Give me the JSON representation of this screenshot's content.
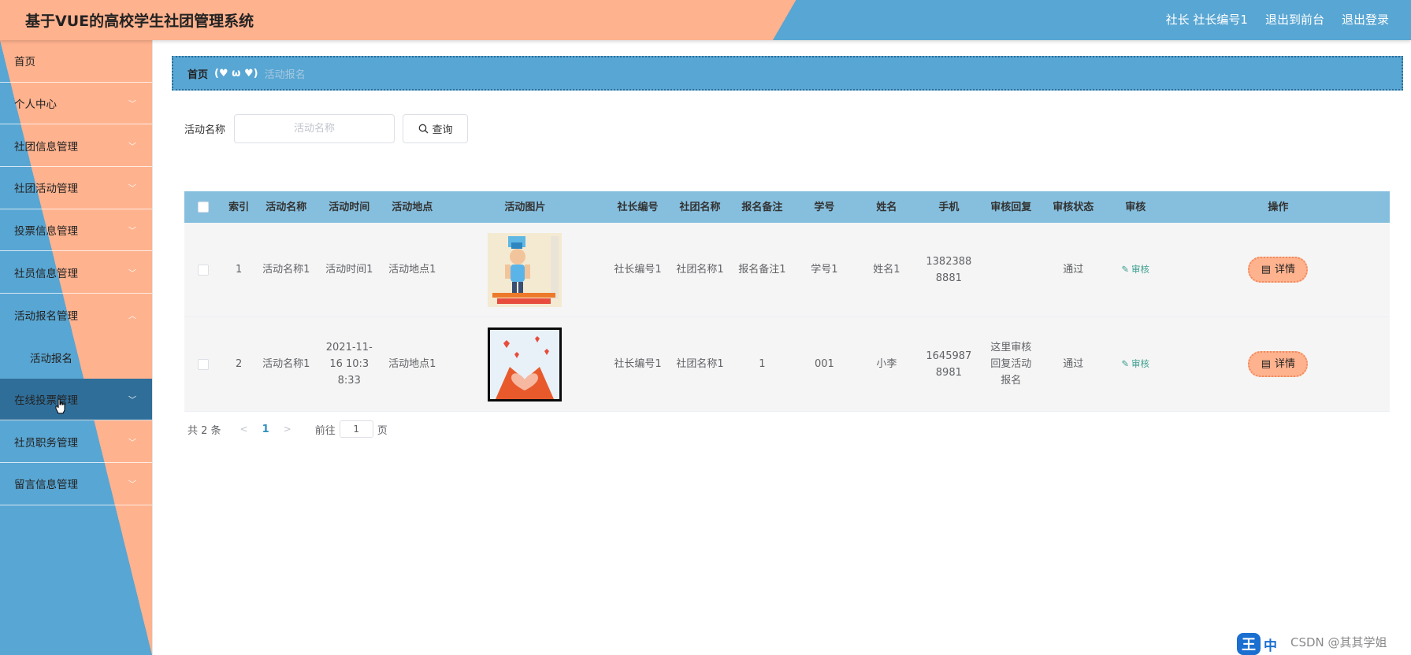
{
  "header": {
    "title": "基于VUE的高校学生社团管理系统",
    "user": "社长 社长编号1",
    "back_front": "退出到前台",
    "logout": "退出登录"
  },
  "sidebar": {
    "items": [
      {
        "label": "首页"
      },
      {
        "label": "个人中心"
      },
      {
        "label": "社团信息管理"
      },
      {
        "label": "社团活动管理"
      },
      {
        "label": "投票信息管理"
      },
      {
        "label": "社员信息管理"
      },
      {
        "label": "活动报名管理"
      },
      {
        "label": "活动报名"
      },
      {
        "label": "在线投票管理"
      },
      {
        "label": "社员职务管理"
      },
      {
        "label": "留言信息管理"
      }
    ]
  },
  "breadcrumb": {
    "home": "首页",
    "sep": "(♥ ω ♥)",
    "current": "活动报名"
  },
  "search": {
    "label": "活动名称",
    "placeholder": "活动名称",
    "button": "查询"
  },
  "table": {
    "headers": [
      "索引",
      "活动名称",
      "活动时间",
      "活动地点",
      "活动图片",
      "社长编号",
      "社团名称",
      "报名备注",
      "学号",
      "姓名",
      "手机",
      "审核回复",
      "审核状态",
      "审核",
      "操作"
    ],
    "rows": [
      {
        "index": "1",
        "name": "活动名称1",
        "time": "活动时间1",
        "location": "活动地点1",
        "leader_id": "社长编号1",
        "club": "社团名称1",
        "note": "报名备注1",
        "student_no": "学号1",
        "student_name": "姓名1",
        "phone": "13823888881",
        "reply": "",
        "status": "通过",
        "review": "审核",
        "detail": "详情"
      },
      {
        "index": "2",
        "name": "活动名称1",
        "time": "2021-11-16 10:38:33",
        "location": "活动地点1",
        "leader_id": "社长编号1",
        "club": "社团名称1",
        "note": "1",
        "student_no": "001",
        "student_name": "小李",
        "phone": "16459878981",
        "reply": "这里审核回复活动报名",
        "status": "通过",
        "review": "审核",
        "detail": "详情"
      }
    ]
  },
  "pagination": {
    "total": "共 2 条",
    "current": "1",
    "goto": "前往",
    "page_input": "1",
    "page_unit": "页"
  },
  "watermark": "CSDN @其其学姐",
  "ime": {
    "logo": "王",
    "lang": "中"
  },
  "colors": {
    "peach": "#ffb28e",
    "blue": "#58a6d3",
    "active": "#2f6e99",
    "table_header": "#86bfde"
  }
}
